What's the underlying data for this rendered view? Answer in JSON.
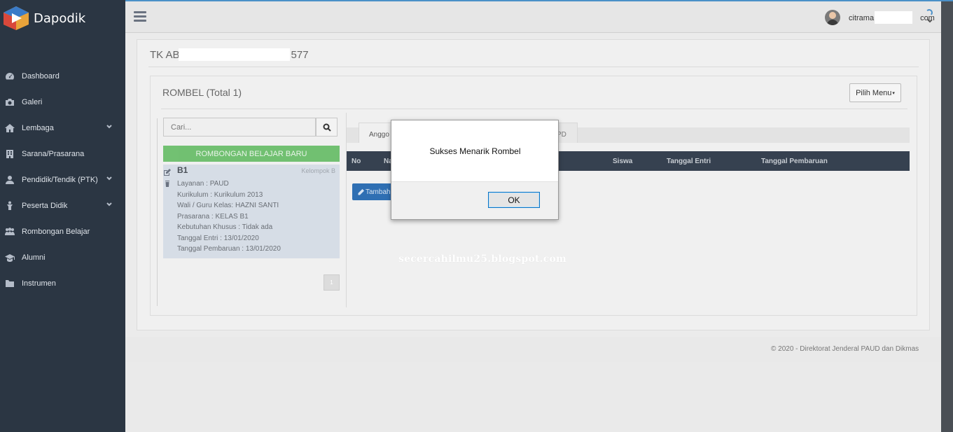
{
  "app": {
    "name": "Dapodik"
  },
  "sidebar": {
    "items": [
      {
        "label": "Dashboard",
        "icon": "dashboard-icon",
        "has_submenu": false
      },
      {
        "label": "Galeri",
        "icon": "camera-icon",
        "has_submenu": false
      },
      {
        "label": "Lembaga",
        "icon": "home-icon",
        "has_submenu": true
      },
      {
        "label": "Sarana/Prasarana",
        "icon": "building-icon",
        "has_submenu": false
      },
      {
        "label": "Pendidik/Tendik (PTK)",
        "icon": "user-icon",
        "has_submenu": true
      },
      {
        "label": "Peserta Didik",
        "icon": "student-icon",
        "has_submenu": true
      },
      {
        "label": "Rombongan Belajar",
        "icon": "group-icon",
        "has_submenu": false
      },
      {
        "label": "Alumni",
        "icon": "graduation-cap-icon",
        "has_submenu": false
      },
      {
        "label": "Instrumen",
        "icon": "folder-icon",
        "has_submenu": false
      }
    ]
  },
  "header": {
    "user_email_prefix": "citrama",
    "user_email_suffix": "com"
  },
  "school": {
    "title_prefix": "TK AB",
    "title_suffix": "577"
  },
  "rombel": {
    "title": "ROMBEL (Total 1)",
    "menu_button": "Pilih Menu",
    "search_placeholder": "Cari...",
    "new_button": "ROMBONGAN BELAJAR BARU",
    "class": {
      "name": "B1",
      "group": "Kelompok B",
      "info": [
        "Layanan : PAUD",
        "Kurikulum : Kurikulum 2013",
        "Wali / Guru Kelas: HAZNI SANTI",
        "Prasarana : KELAS B1",
        "Kebutuhan Khusus : Tidak ada",
        "Tanggal Entri : 13/01/2020",
        "Tanggal Pembaruan : 13/01/2020"
      ]
    },
    "pager": "1",
    "tabs": {
      "active": "Anggo",
      "other": "PD"
    },
    "table": {
      "columns": [
        "No",
        "Na",
        "Siswa",
        "Tanggal Entri",
        "Tanggal Pembaruan"
      ]
    },
    "add_button": "Tambah"
  },
  "footer": {
    "text": "©   2020 - Direktorat Jenderal PAUD dan Dikmas"
  },
  "watermark": "secercahilmu25.blogspot.com",
  "dialog": {
    "message": "Sukses Menarik Rombel",
    "ok": "OK"
  },
  "colors": {
    "sidebar": "#2b3643",
    "accent": "#4a90c8",
    "success": "#5cb85c",
    "primary": "#2f6fb3",
    "table_head": "#364150"
  }
}
